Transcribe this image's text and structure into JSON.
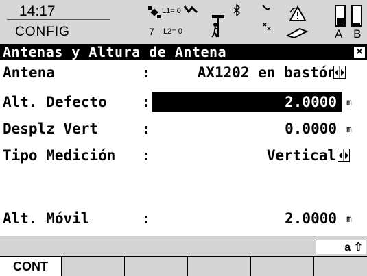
{
  "status": {
    "time": "14:17",
    "mode": "CONFIG",
    "gnss_l1": "L1= 0",
    "gnss_l2": "L2= 0",
    "satellites": "7",
    "battery_labels": "A B",
    "icons": [
      "satellite-icon",
      "antenna-icon",
      "bluetooth-icon",
      "radio-icon",
      "warning-icon",
      "memory-card-icon",
      "battery-icon"
    ]
  },
  "title": {
    "text": "Antenas y Altura de Antena",
    "close": "×"
  },
  "fields": [
    {
      "label": "Antena",
      "value": "AX1202 en bastón",
      "unit": "",
      "has_spinner": true
    },
    {
      "label": "Alt. Defecto",
      "value": "2.0000",
      "unit": "m",
      "has_spinner": false,
      "selected": true
    },
    {
      "label": "Desplz Vert",
      "value": "0.0000",
      "unit": "m",
      "has_spinner": false
    },
    {
      "label": "Tipo Medición",
      "value": "Vertical",
      "unit": "",
      "has_spinner": true
    },
    {
      "label": "Alt. Móvil",
      "value": "2.0000",
      "unit": "m",
      "has_spinner": false
    }
  ],
  "input_mode": "a ⇧",
  "fkeys": [
    "CONT",
    "",
    "",
    "",
    "",
    ""
  ]
}
